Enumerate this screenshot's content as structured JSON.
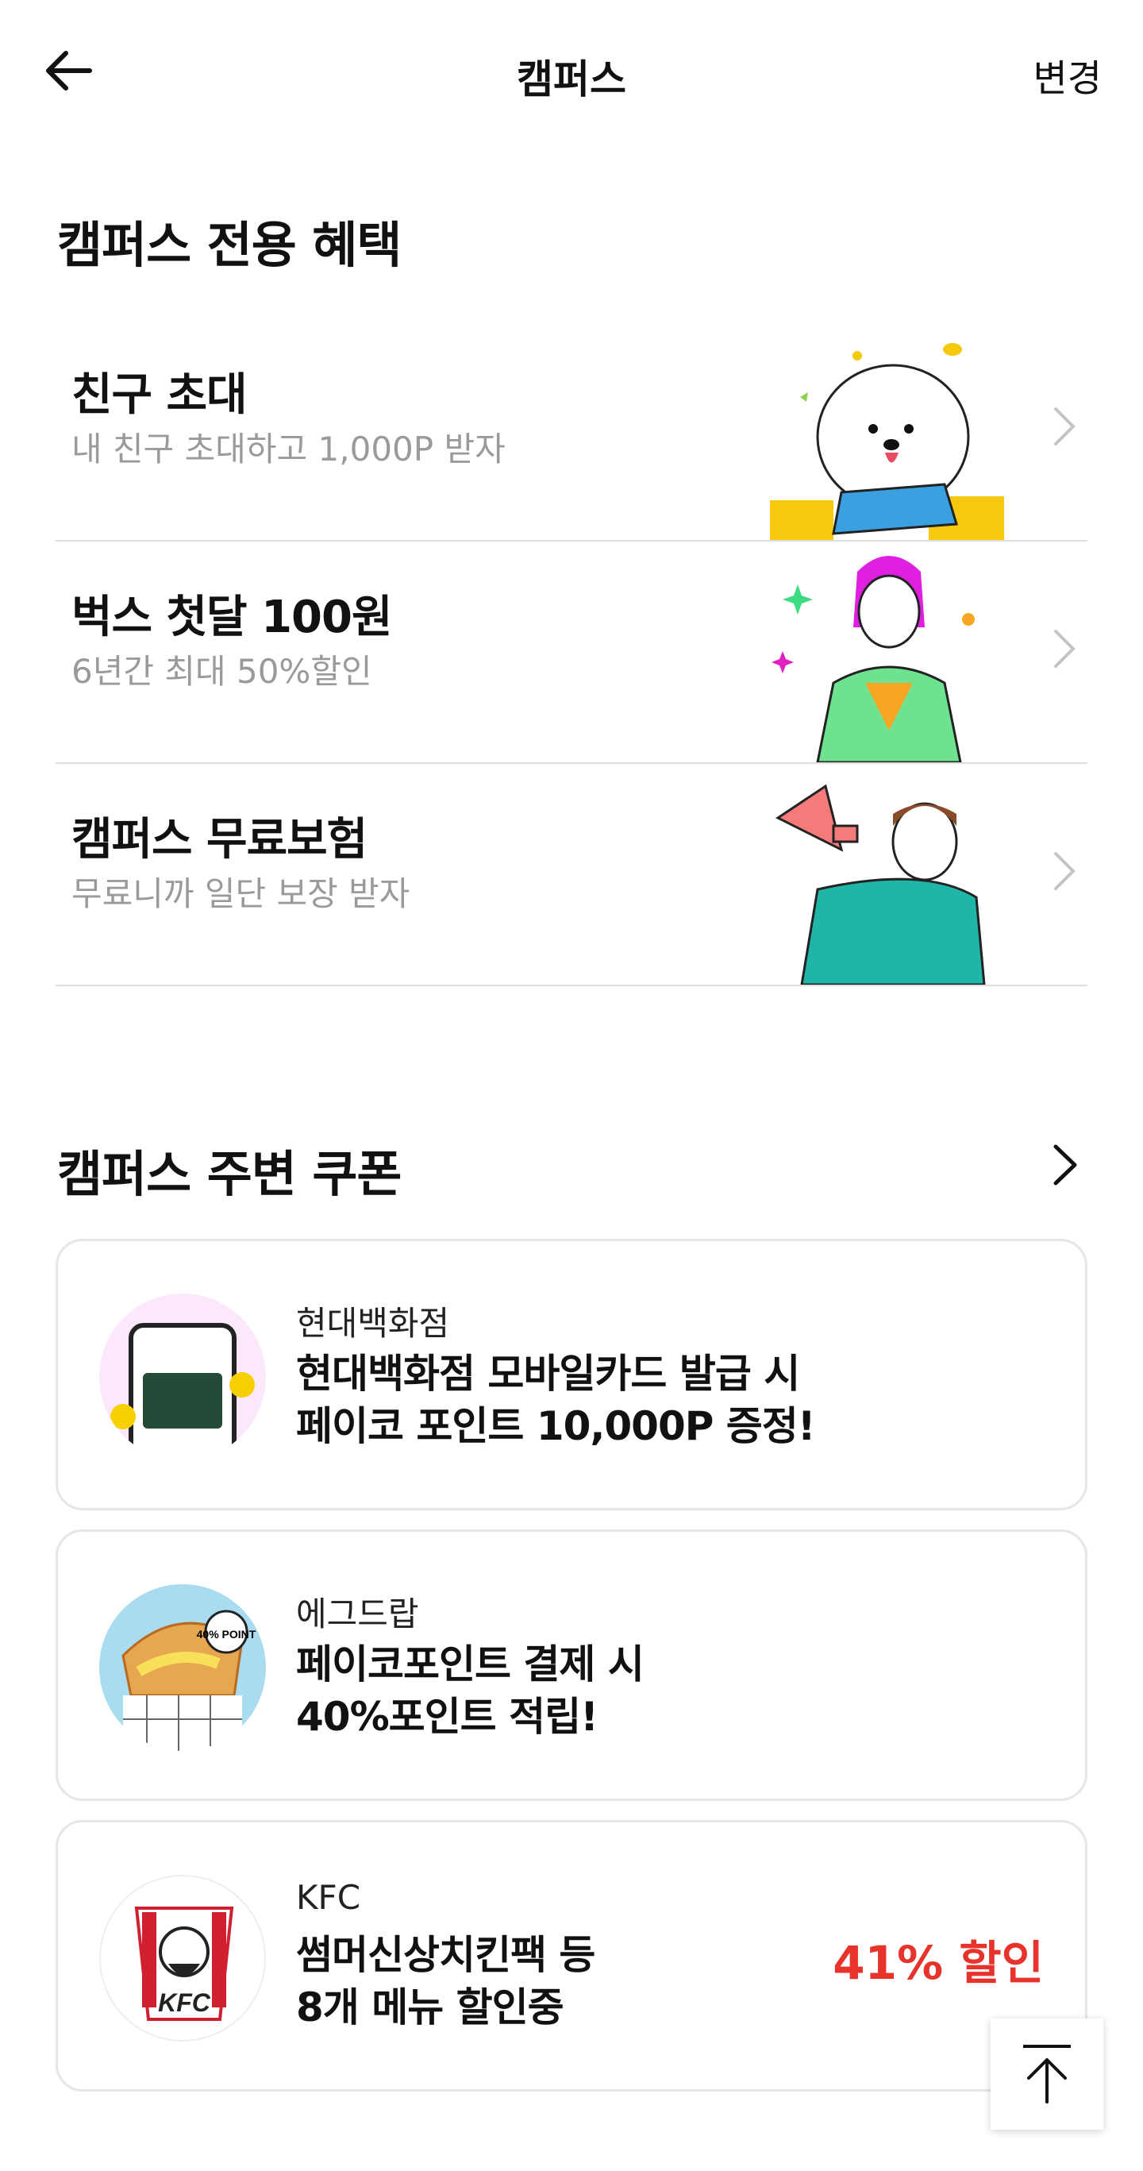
{
  "header": {
    "title": "캠퍼스",
    "change_label": "변경"
  },
  "benefits": {
    "title": "캠퍼스 전용 혜택",
    "items": [
      {
        "title": "친구 초대",
        "subtitle": "내 친구 초대하고 1,000P 받자",
        "illustration": "dog-with-coins"
      },
      {
        "title": "벅스 첫달 100원",
        "subtitle": "6년간 최대 50%할인",
        "illustration": "woman-listening"
      },
      {
        "title": "캠퍼스 무료보험",
        "subtitle": "무료니까 일단 보장 받자",
        "illustration": "man-with-megaphone"
      }
    ]
  },
  "coupons": {
    "title": "캠퍼스 주변 쿠폰",
    "items": [
      {
        "brand": "현대백화점",
        "line1": "현대백화점 모바일카드 발급 시",
        "line2": "페이코 포인트 10,000P 증정!",
        "badge": ""
      },
      {
        "brand": "에그드랍",
        "line1": "페이코포인트 결제 시",
        "line2": "40%포인트 적립!",
        "badge": "",
        "thumb_text": "40% POINT"
      },
      {
        "brand": "KFC",
        "line1": "썸머신상치킨팩 등",
        "line2": "8개 메뉴 할인중",
        "badge": "41% 할인",
        "logo_text": "KFC"
      }
    ]
  },
  "colors": {
    "accent_red": "#e8332c",
    "divider": "#dddddd",
    "subtext": "#9a9a9a"
  }
}
